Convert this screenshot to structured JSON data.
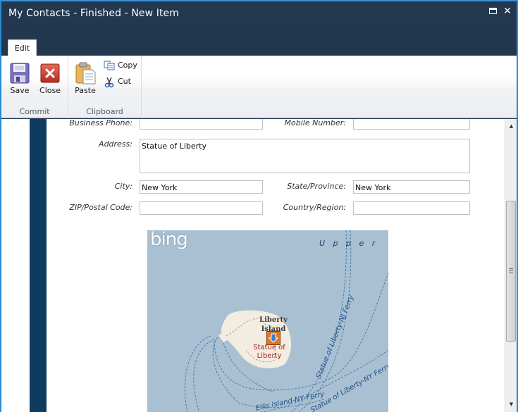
{
  "window": {
    "title": "My Contacts - Finished - New Item",
    "maximize_icon": "maximize-icon",
    "close_icon": "close-icon"
  },
  "ribbon": {
    "tabs": [
      {
        "label": "Edit",
        "active": true
      }
    ],
    "groups": [
      {
        "label": "Commit",
        "buttons": [
          {
            "label": "Save",
            "icon": "floppy-disk-icon"
          },
          {
            "label": "Close",
            "icon": "close-x-icon"
          }
        ]
      },
      {
        "label": "Clipboard",
        "buttons": [
          {
            "label": "Paste",
            "icon": "clipboard-icon"
          },
          {
            "label": "Copy",
            "icon": "copy-icon"
          },
          {
            "label": "Cut",
            "icon": "scissors-icon"
          }
        ]
      }
    ]
  },
  "form": {
    "business_phone": {
      "label": "Business Phone:",
      "value": ""
    },
    "mobile_number": {
      "label": "Mobile Number:",
      "value": ""
    },
    "address": {
      "label": "Address:",
      "value": "Statue of Liberty"
    },
    "city": {
      "label": "City:",
      "value": "New York"
    },
    "state": {
      "label": "State/Province:",
      "value": "New York"
    },
    "zip": {
      "label": "ZIP/Postal Code:",
      "value": ""
    },
    "country": {
      "label": "Country/Region:",
      "value": ""
    }
  },
  "map": {
    "provider_logo": "bing",
    "labels": {
      "water": "U p p e r",
      "island": "Liberty Island",
      "poi": "Statue of Liberty",
      "ferry_nj": "Statue of Liberty-NJ Ferry",
      "ferry_ny": "Statue of Liberty-NY Ferry",
      "ferry_ellis": "Ellis Island-NY Ferry"
    },
    "pin_icon": "map-pin-icon",
    "colors": {
      "water": "#a9c0d2",
      "land": "#f3ece0",
      "poi_text": "#a8201a",
      "route": "#4a7aa8",
      "pin": "#e8761e"
    }
  },
  "scrollbar": {
    "position": 0.28
  },
  "colors": {
    "titlebar": "#1f3550",
    "accent_border": "#2a8ad4",
    "left_stripe": "#0f3b5e"
  }
}
